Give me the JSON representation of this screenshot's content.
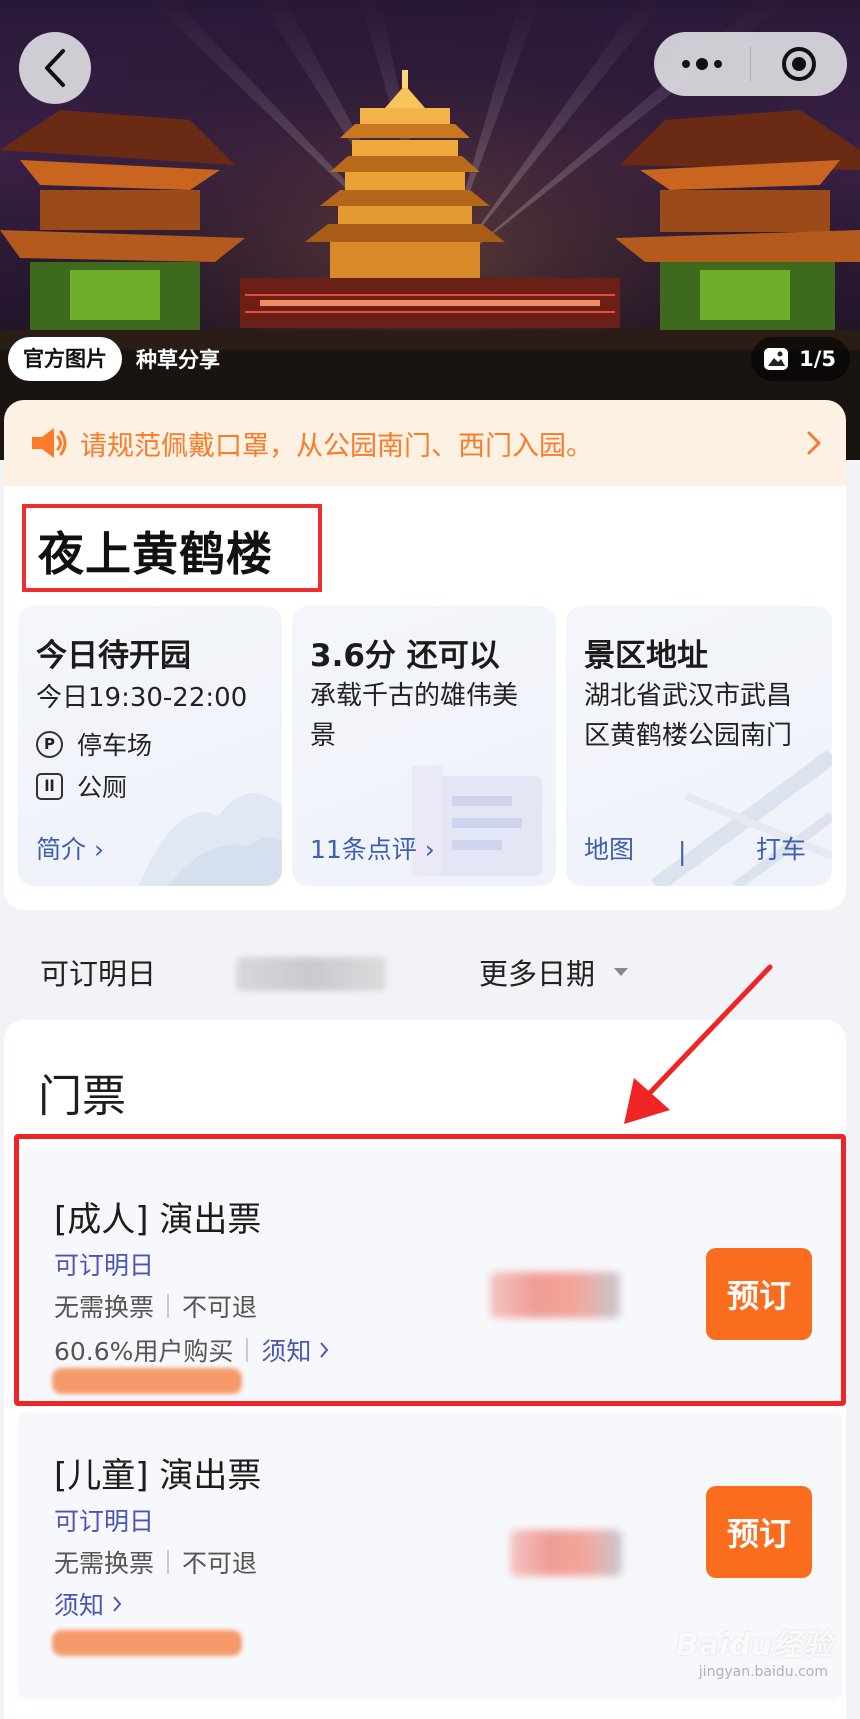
{
  "hero": {
    "photo_tabs": [
      "官方图片",
      "种草分享"
    ],
    "counter": "1/5"
  },
  "notice": {
    "text": "请规范佩戴口罩，从公园南门、西门入园。"
  },
  "scenic": {
    "title": "夜上黄鹤楼",
    "hours_card": {
      "heading": "今日待开园",
      "hours": "今日19:30-22:00",
      "amenities": [
        {
          "icon": "parking-icon",
          "label": "停车场"
        },
        {
          "icon": "toilet-icon",
          "label": "公厕"
        }
      ],
      "link": "简介"
    },
    "rating_card": {
      "heading": "3.6分 还可以",
      "desc": "承载千古的雄伟美景",
      "link": "11条点评"
    },
    "address_card": {
      "heading": "景区地址",
      "address": "湖北省武汉市武昌区黄鹤楼公园南门",
      "map_link": "地图",
      "separator": "|",
      "taxi_link": "打车"
    }
  },
  "date_row": {
    "label": "可订明日",
    "more": "更多日期"
  },
  "tickets": {
    "section_title": "门票",
    "items": [
      {
        "name": "[成人] 演出票",
        "availability": "可订明日",
        "tags": [
          "无需换票",
          "不可退"
        ],
        "buy_rate": "60.6%用户购买",
        "notice_link": "须知",
        "book_label": "预订"
      },
      {
        "name": "[儿童] 演出票",
        "availability": "可订明日",
        "tags": [
          "无需换票",
          "不可退"
        ],
        "buy_rate": "",
        "notice_link": "须知",
        "book_label": "预订"
      }
    ]
  },
  "watermark": {
    "brand": "Baidu经验",
    "url": "jingyan.baidu.com"
  },
  "colors": {
    "accent_orange": "#fa6d1e",
    "link_blue": "#3d5fb0",
    "notice_bg": "#fdf1e4",
    "highlight_red": "#ef2424"
  }
}
